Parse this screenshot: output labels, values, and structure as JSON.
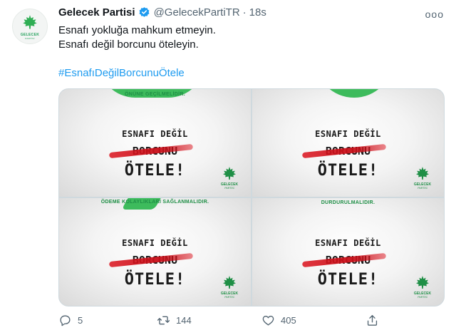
{
  "tweet": {
    "author_name": "Gelecek Partisi",
    "handle": "@GelecekPartiTR",
    "separator": "·",
    "time": "18s",
    "more_label": "ooo",
    "lines": [
      "Esnafı yokluğa mahkum etmeyin.",
      "Esnafı değil borcunu öteleyin."
    ],
    "hashtag": "#EsnafıDeğilBorcunuÖtele"
  },
  "avatar": {
    "brand": "GELECEK",
    "sub": "PARTİSİ"
  },
  "media": {
    "tiles": [
      {
        "top": "ÖNÜNE GEÇİLMELİDİR.",
        "line1": "ESNAFI DEĞİL",
        "line2": "BORCUNU",
        "line3": "ÖTELE!",
        "brand": "GELECEK",
        "sub": "PARTİSİ"
      },
      {
        "top": "",
        "line1": "ESNAFI DEĞİL",
        "line2": "BORCUNU",
        "line3": "ÖTELE!",
        "brand": "GELECEK",
        "sub": "PARTİSİ"
      },
      {
        "top": "ÖDEME KOLAYLIKLARI SAĞLANMALIDIR.",
        "line1": "ESNAFI DEĞİL",
        "line2": "BORCUNU",
        "line3": "ÖTELE!",
        "brand": "GELECEK",
        "sub": "PARTİSİ"
      },
      {
        "top": "DURDURULMALIDIR.",
        "line1": "ESNAFI DEĞİL",
        "line2": "BORCUNU",
        "line3": "ÖTELE!",
        "brand": "GELECEK",
        "sub": "PARTİSİ"
      }
    ]
  },
  "actions": {
    "reply_count": "5",
    "retweet_count": "144",
    "like_count": "405"
  },
  "colors": {
    "accent": "#1d9bf0",
    "brand_green": "#3dbb5c",
    "strike_red": "#d0141e",
    "muted": "#536471"
  },
  "icons": [
    "verified-badge-icon",
    "more-icon",
    "reply-icon",
    "retweet-icon",
    "like-icon",
    "share-icon",
    "maple-leaf-icon"
  ]
}
